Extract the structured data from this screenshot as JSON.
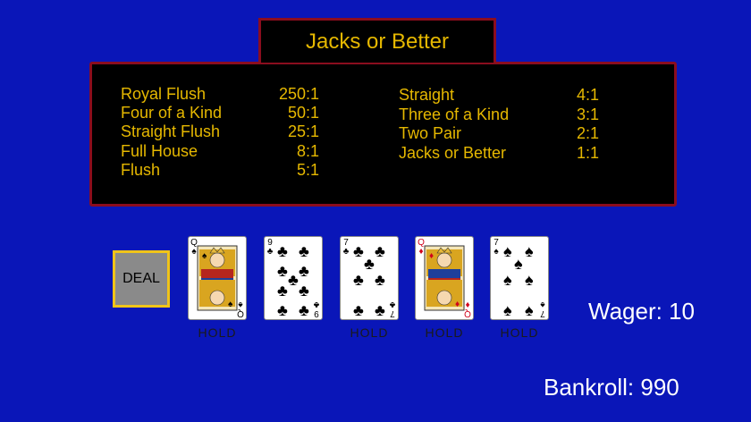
{
  "game": {
    "title": "Jacks or Better"
  },
  "paytable": {
    "left": [
      {
        "hand": "Royal Flush",
        "payout": "250:1"
      },
      {
        "hand": "Four of a Kind",
        "payout": "50:1"
      },
      {
        "hand": "Straight Flush",
        "payout": "25:1"
      },
      {
        "hand": "Full House",
        "payout": "8:1"
      },
      {
        "hand": "Flush",
        "payout": "5:1"
      }
    ],
    "right": [
      {
        "hand": "Straight",
        "payout": "4:1"
      },
      {
        "hand": "Three of a Kind",
        "payout": "3:1"
      },
      {
        "hand": "Two Pair",
        "payout": "2:1"
      },
      {
        "hand": "Jacks or Better",
        "payout": "1:1"
      }
    ]
  },
  "deal_button": {
    "label": "DEAL"
  },
  "cards": [
    {
      "rank": "Q",
      "suit": "spades",
      "suit_glyph": "♠",
      "hold_label": "HOLD",
      "held": true
    },
    {
      "rank": "9",
      "suit": "clubs",
      "suit_glyph": "♣",
      "hold_label": "",
      "held": false
    },
    {
      "rank": "7",
      "suit": "clubs",
      "suit_glyph": "♣",
      "hold_label": "HOLD",
      "held": true
    },
    {
      "rank": "Q",
      "suit": "diamonds",
      "suit_glyph": "♦",
      "hold_label": "HOLD",
      "held": true
    },
    {
      "rank": "7",
      "suit": "spades",
      "suit_glyph": "♠",
      "hold_label": "HOLD",
      "held": true
    }
  ],
  "wager": {
    "text": "Wager: 10",
    "value": 10
  },
  "bankroll": {
    "text": "Bankroll: 990",
    "value": 990
  },
  "colors": {
    "table_background": "#0a16b8",
    "paytable_text": "#e6b800",
    "panel_border": "#8b0d1e",
    "deal_border": "#f0c419"
  }
}
